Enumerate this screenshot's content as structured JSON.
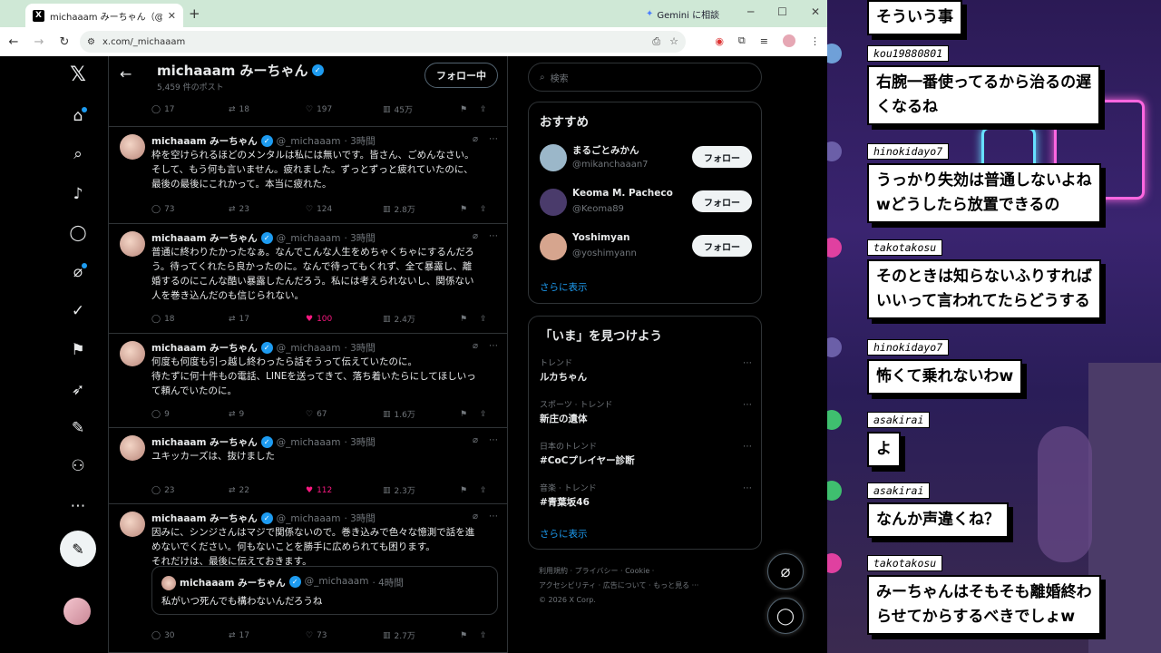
{
  "browser": {
    "tab_title": "michaaam みーちゃん（@_michaaam",
    "tab_icon": "x-logo-icon",
    "new_tab": "+",
    "gemini_label": "Gemini に相談",
    "url": "x.com/_michaaam"
  },
  "x": {
    "header": {
      "name": "michaaam みーちゃん",
      "post_count": "5,459 件のポスト",
      "follow_button": "フォロー中"
    },
    "top_actions": {
      "reply": "17",
      "repost": "18",
      "like": "197",
      "views": "45万"
    },
    "tweets": [
      {
        "name": "michaaam みーちゃん",
        "handle": "@_michaaam",
        "time": "· 3時間",
        "text": "枠を空けられるほどのメンタルは私には無いです。皆さん、ごめんなさい。\nそして、もう何も言いません。疲れました。ずっとずっと疲れていたのに、\n最後の最後にこれかって。本当に疲れた。",
        "reply": "73",
        "repost": "23",
        "like": "124",
        "views": "2.8万",
        "liked": false
      },
      {
        "name": "michaaam みーちゃん",
        "handle": "@_michaaam",
        "time": "· 3時間",
        "text": "普通に終わりたかったなぁ。なんでこんな人生をめちゃくちゃにするんだろ\nう。待ってくれたら良かったのに。なんで待ってもくれず、全て暴露し、離\n婚するのにこんな酷い暴露したんだろう。私には考えられないし、関係ない\n人を巻き込んだのも信じられない。",
        "reply": "18",
        "repost": "17",
        "like": "100",
        "views": "2.4万",
        "liked": true
      },
      {
        "name": "michaaam みーちゃん",
        "handle": "@_michaaam",
        "time": "· 3時間",
        "text": "何度も何度も引っ越し終わったら話そうって伝えていたのに。\n待たずに何十件もの電話、LINEを送ってきて、落ち着いたらにしてほしいっ\nて頼んでいたのに。",
        "reply": "9",
        "repost": "9",
        "like": "67",
        "views": "1.6万",
        "liked": false
      },
      {
        "name": "michaaam みーちゃん",
        "handle": "@_michaaam",
        "time": "· 3時間",
        "text": "ユキッカーズは、抜けました",
        "reply": "23",
        "repost": "22",
        "like": "112",
        "views": "2.3万",
        "liked": true
      },
      {
        "name": "michaaam みーちゃん",
        "handle": "@_michaaam",
        "time": "· 3時間",
        "text": "因みに、シンジさんはマジで関係ないので。巻き込みで色々な憶測で話を進\nめないでください。何もないことを勝手に広められても困ります。\nそれだけは、最後に伝えておきます。",
        "quote": {
          "name": "michaaam みーちゃん",
          "handle": "@_michaaam",
          "time": "· 4時間",
          "text": "私がいつ死んでも構わないんだろうね"
        },
        "reply": "30",
        "repost": "17",
        "like": "73",
        "views": "2.7万",
        "liked": false
      }
    ],
    "search_placeholder": "検索",
    "recommend": {
      "title": "おすすめ",
      "users": [
        {
          "name": "まるごとみかん",
          "handle": "@mikanchaaan7",
          "button": "フォロー",
          "color": "#9bb7c9"
        },
        {
          "name": "Keoma M. Pacheco",
          "handle": "@Keoma89",
          "button": "フォロー",
          "color": "#4a3b6b"
        },
        {
          "name": "Yoshimyan",
          "handle": "@yoshimyann",
          "button": "フォロー",
          "color": "#d6a58e"
        }
      ],
      "more": "さらに表示"
    },
    "trends": {
      "title": "「いま」を見つけよう",
      "items": [
        {
          "cat": "トレンド",
          "title": "ルカちゃん"
        },
        {
          "cat": "スポーツ · トレンド",
          "title": "新庄の遺体"
        },
        {
          "cat": "日本のトレンド",
          "title": "#CoCプレイヤー診断"
        },
        {
          "cat": "音楽 · トレンド",
          "title": "#青葉坂46"
        }
      ],
      "more": "さらに表示"
    },
    "footer": {
      "line1": "利用規約 · プライバシー · Cookie ·",
      "line2": "アクセシビリティ · 広告について · もっと見る ···",
      "line3": "© 2026 X Corp."
    }
  },
  "chat": [
    {
      "name": "",
      "text": "そういう事",
      "color": ""
    },
    {
      "name": "kou19880801",
      "text": "右腕一番使ってるから治るの遅\nくなるね",
      "color": "#6fa0d8"
    },
    {
      "name": "hinokidayo7",
      "text": "うっかり失効は普通しないよね\nwどうしたら放置できるの",
      "color": "#6b5fa8"
    },
    {
      "name": "takotakosu",
      "text": "そのときは知らないふりすれば\nいいって言われてたらどうする",
      "color": "#e040a0"
    },
    {
      "name": "hinokidayo7",
      "text": "怖くて乗れないわw",
      "color": "#6b5fa8"
    },
    {
      "name": "asakirai",
      "text": "よ",
      "color": "#3fbf6f"
    },
    {
      "name": "asakirai",
      "text": "なんか声違くね？",
      "color": "#3fbf6f"
    },
    {
      "name": "takotakosu",
      "text": "みーちゃんはそもそも離婚終わ\nらせてからするべきでしょw",
      "color": "#e040a0"
    }
  ],
  "colors": {
    "x_bg": "#000000",
    "accent": "#1d9bf0",
    "like": "#f91880"
  }
}
